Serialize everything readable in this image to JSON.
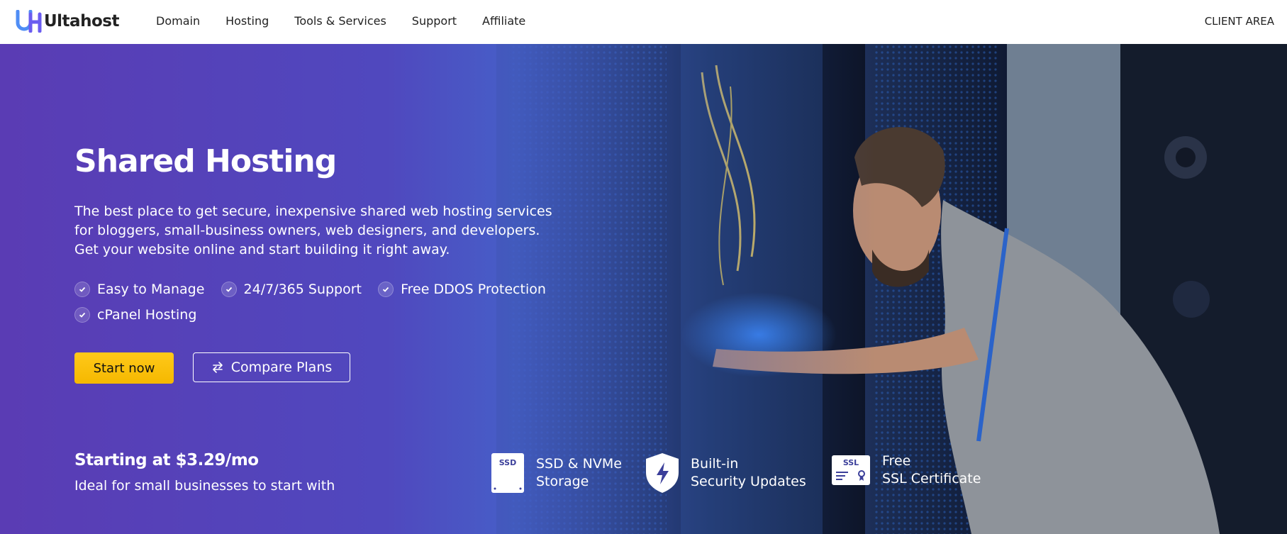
{
  "brand": {
    "name": "Ultahost"
  },
  "nav": {
    "items": [
      "Domain",
      "Hosting",
      "Tools & Services",
      "Support",
      "Affiliate"
    ],
    "client_area": "CLIENT AREA"
  },
  "hero": {
    "title": "Shared Hosting",
    "description": "The best place to get secure, inexpensive shared web hosting services for bloggers, small-business owners, web designers, and developers. Get your website online and start building it right away.",
    "features": [
      "Easy to Manage",
      "24/7/365 Support",
      "Free DDOS Protection",
      "cPanel Hosting"
    ],
    "start_button": "Start now",
    "compare_button": "Compare Plans",
    "price": "Starting at $3.29/mo",
    "price_sub": "Ideal for small businesses to start with"
  },
  "perks": [
    {
      "icon": "ssd-icon",
      "badge": "SSD",
      "line1": "SSD & NVMe",
      "line2": "Storage"
    },
    {
      "icon": "shield-bolt-icon",
      "line1": "Built-in",
      "line2": "Security Updates"
    },
    {
      "icon": "ssl-certificate-icon",
      "badge": "SSL",
      "line1": "Free",
      "line2": "SSL Certificate"
    }
  ],
  "colors": {
    "accent_yellow": "#f5b800",
    "hero_purple": "#5a3db3",
    "logo_blue": "#4f7cf0"
  }
}
